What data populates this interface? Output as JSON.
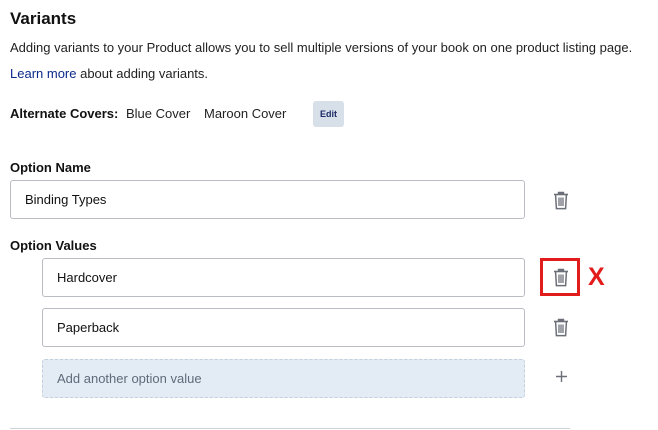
{
  "variants": {
    "title": "Variants",
    "description": "Adding variants to your Product allows you to sell multiple versions of your book on one product listing page.",
    "learn_more_link": "Learn more",
    "learn_more_suffix": " about adding variants."
  },
  "alternate_covers": {
    "label": "Alternate Covers:",
    "values": [
      "Blue Cover",
      "Maroon Cover"
    ],
    "edit_label": "Edit"
  },
  "option_name": {
    "label": "Option Name",
    "value": "Binding Types"
  },
  "option_values": {
    "label": "Option Values",
    "items": [
      "Hardcover",
      "Paperback"
    ],
    "add_placeholder": "Add another option value"
  },
  "annotation": {
    "mark": "X",
    "color": "#e21b1b"
  },
  "icons": {
    "delete": "trash-icon",
    "add": "plus-icon"
  }
}
